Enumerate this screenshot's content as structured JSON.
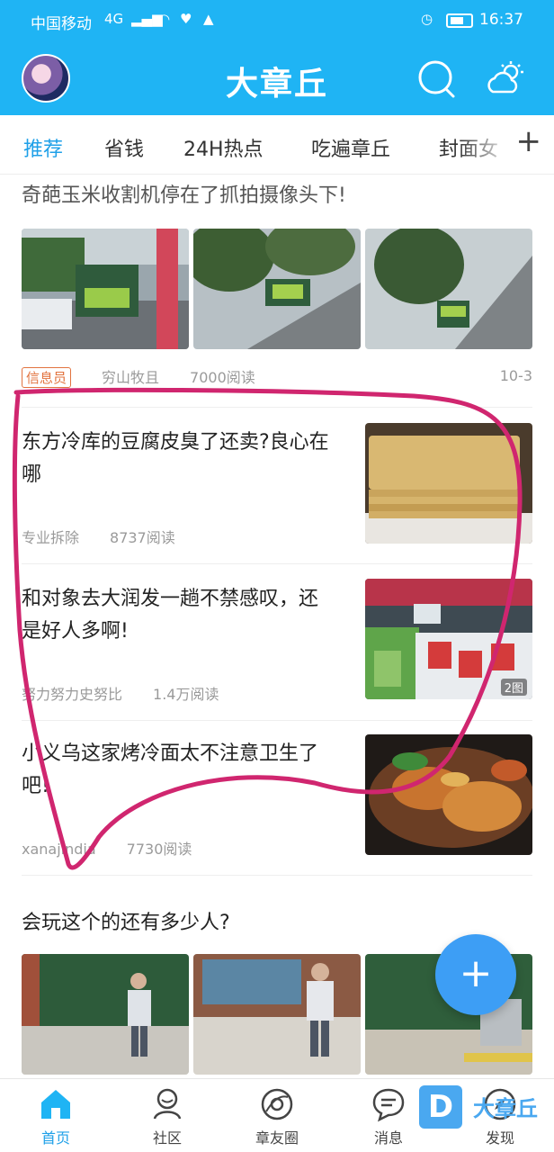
{
  "status_bar": {
    "carrier": "中国移动",
    "network": "4G",
    "time": "16:37"
  },
  "header": {
    "title": "大章丘"
  },
  "tabs": [
    {
      "label": "推荐",
      "active": true
    },
    {
      "label": "省钱"
    },
    {
      "label": "24H热点"
    },
    {
      "label": "吃遍章丘"
    },
    {
      "label": "封面女"
    }
  ],
  "feed": [
    {
      "title": "奇葩玉米收割机停在了抓拍摄像头下!",
      "badge": "信息员",
      "author": "穷山牧且",
      "reads": "7000阅读",
      "date": "10-3"
    },
    {
      "title": "东方冷库的豆腐皮臭了还卖?良心在哪",
      "author": "专业拆除",
      "reads": "8737阅读"
    },
    {
      "title": "和对象去大润发一趟不禁感叹，还是好人多啊!",
      "author": "努力努力史努比",
      "reads": "1.4万阅读",
      "image_count": "2图"
    },
    {
      "title": "小义乌这家烤冷面太不注意卫生了吧!",
      "author": "xanajindia",
      "reads": "7730阅读"
    },
    {
      "title": "会玩这个的还有多少人?"
    }
  ],
  "fab": {
    "label": "+"
  },
  "bottom_nav": [
    {
      "label": "首页",
      "icon": "home-icon",
      "active": true
    },
    {
      "label": "社区",
      "icon": "community-icon"
    },
    {
      "label": "章友圈",
      "icon": "circle-icon"
    },
    {
      "label": "消息",
      "icon": "message-icon"
    },
    {
      "label": "发现",
      "icon": "discover-icon"
    }
  ],
  "watermark": {
    "letter": "D",
    "text": "大章丘"
  },
  "colors": {
    "brand": "#1fb4f4",
    "active_tab": "#1fa0e8",
    "badge": "#e2733f",
    "annotation": "#d0266f",
    "fab": "#3d9ef5"
  }
}
